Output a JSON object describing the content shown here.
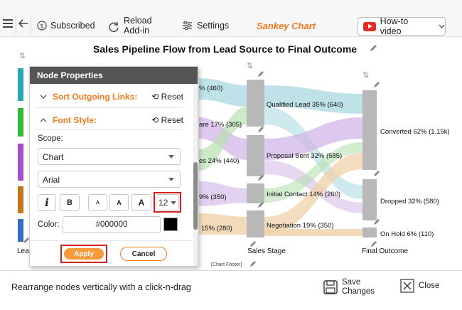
{
  "toolbar": {
    "subscribed_label": "Subscribed",
    "reload_label_line1": "Reload",
    "reload_label_line2": "Add-in",
    "settings_label": "Settings",
    "brand_label": "Sankey Chart",
    "howto_label": "How-to video"
  },
  "chart": {
    "title": "Sales Pipeline Flow from Lead Source to Final Outcome",
    "footer": "[Chart Footer]",
    "stage_labels": {
      "left": "Lea",
      "middle": "Sales Stage",
      "right": "Final Outcome"
    },
    "left_partial_labels": [
      "% (460)",
      "are 17% (305)",
      "es 24% (440)",
      "9% (350)",
      "15% (280)"
    ],
    "middle_nodes": [
      "Qualified Lead 35% (640)",
      "Proposal Sent 32% (585)",
      "Initial Contact 14% (260)",
      "Negotiation 19% (350)"
    ],
    "right_nodes": [
      "Converted 62% (1.15k)",
      "Dropped 32% (580)",
      "On Hold 6% (110)"
    ],
    "colors": {
      "flow_blue": "#a8d8e0",
      "flow_purple": "#cfb2e6",
      "flow_green": "#b8e0b0",
      "flow_tan": "#f0d2a8",
      "node_gray": "#b8b8b8"
    }
  },
  "panel": {
    "title": "Node Properties",
    "sort_label": "Sort Outgoing Links:",
    "font_label": "Font Style:",
    "reset_label": "Reset",
    "scope_label": "Scope:",
    "scope_value": "Chart",
    "font_value": "Arial",
    "italic_glyph": "i",
    "bold_glyph": "B",
    "size_small": "A",
    "size_medium": "A",
    "size_large": "A",
    "font_size_value": "12",
    "color_label": "Color:",
    "color_value": "#000000",
    "apply_label": "Apply",
    "cancel_label": "Cancel",
    "swatch_colors": [
      "#2aa7b4",
      "#2fbb35",
      "#a64dc8",
      "#c3761a",
      "#2f6fc4"
    ]
  },
  "statusbar": {
    "hint": "Rearrange nodes vertically with a click-n-drag",
    "save_line1": "Save",
    "save_line2": "Changes",
    "close_label": "Close"
  }
}
